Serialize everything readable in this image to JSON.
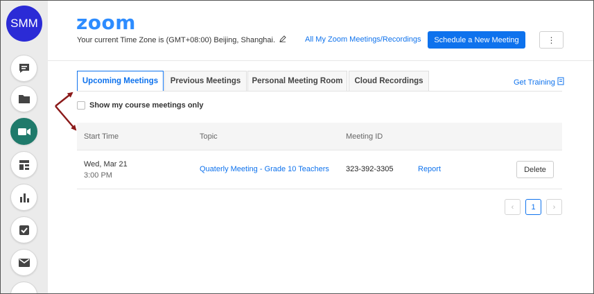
{
  "rail": {
    "avatar_initials": "SMM",
    "items": [
      {
        "name": "chat",
        "icon": "chat-icon"
      },
      {
        "name": "files",
        "icon": "folder-icon"
      },
      {
        "name": "meetings",
        "icon": "video-camera-icon",
        "active": true
      },
      {
        "name": "dashboard",
        "icon": "dashboard-icon"
      },
      {
        "name": "reports",
        "icon": "bar-chart-icon"
      },
      {
        "name": "tasks",
        "icon": "checkbox-icon"
      },
      {
        "name": "mail",
        "icon": "mail-icon"
      }
    ],
    "active_color": "#1f7a6b"
  },
  "header": {
    "logo": "zoom",
    "timezone_text": "Your current Time Zone is (GMT+08:00) Beijing, Shanghai.",
    "all_meetings_link": "All My Zoom Meetings/Recordings",
    "schedule_button": "Schedule a New Meeting",
    "more_button": "⋮"
  },
  "tabs": [
    {
      "label": "Upcoming Meetings",
      "active": true
    },
    {
      "label": "Previous Meetings"
    },
    {
      "label": "Personal Meeting Room"
    },
    {
      "label": "Cloud Recordings"
    }
  ],
  "get_training": "Get Training",
  "filter": {
    "label": "Show my course meetings only",
    "checked": false
  },
  "table": {
    "headers": [
      "Start Time",
      "Topic",
      "Meeting ID"
    ],
    "rows": [
      {
        "date": "Wed, Mar 21",
        "time": "3:00 PM",
        "topic": "Quaterly Meeting - Grade 10 Teachers",
        "meeting_id": "323-392-3305",
        "report": "Report",
        "delete": "Delete"
      }
    ]
  },
  "pagination": {
    "prev": "‹",
    "current": "1",
    "next": "›"
  },
  "colors": {
    "accent": "#0e72ed",
    "logo": "#2d8cff",
    "arrow": "#8b1a1a"
  }
}
